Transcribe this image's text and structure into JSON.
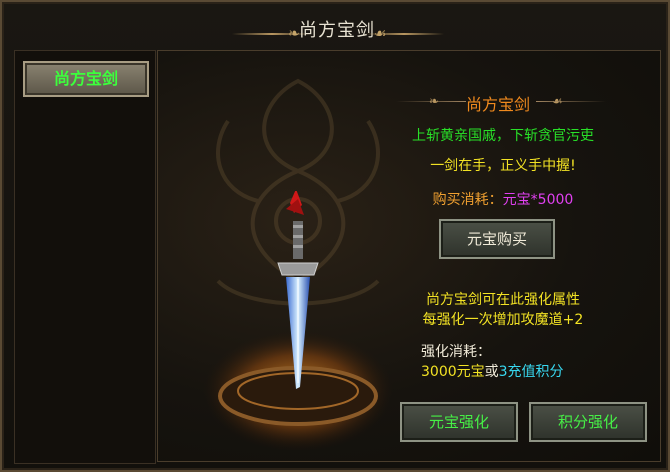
{
  "window": {
    "title": "尚方宝剑"
  },
  "sidebar": {
    "items": [
      {
        "label": "尚方宝剑"
      }
    ]
  },
  "main": {
    "header": "尚方宝剑",
    "desc_line1": "上斩黄亲国戚，下斩贪官污吏",
    "desc_line2": "一剑在手，正义手中握!",
    "buy_cost_label": "购买消耗：",
    "buy_cost_value": "元宝*5000",
    "buy_button": "元宝购买",
    "enhance_info_line1": "尚方宝剑可在此强化属性",
    "enhance_info_line2": "每强化一次增加攻魔道+2",
    "enhance_cost_label": "强化消耗：",
    "enhance_cost_part1": "3000元宝",
    "enhance_cost_or": "或",
    "enhance_cost_part2": "3充值积分",
    "enhance_yuanbao_button": "元宝强化",
    "enhance_points_button": "积分强化"
  },
  "colors": {
    "green_text": "#28e028",
    "yellow_text": "#f2e224",
    "orange_title": "#f08a1e",
    "magenta_value": "#e040f0",
    "cyan_value": "#38d8f0"
  }
}
